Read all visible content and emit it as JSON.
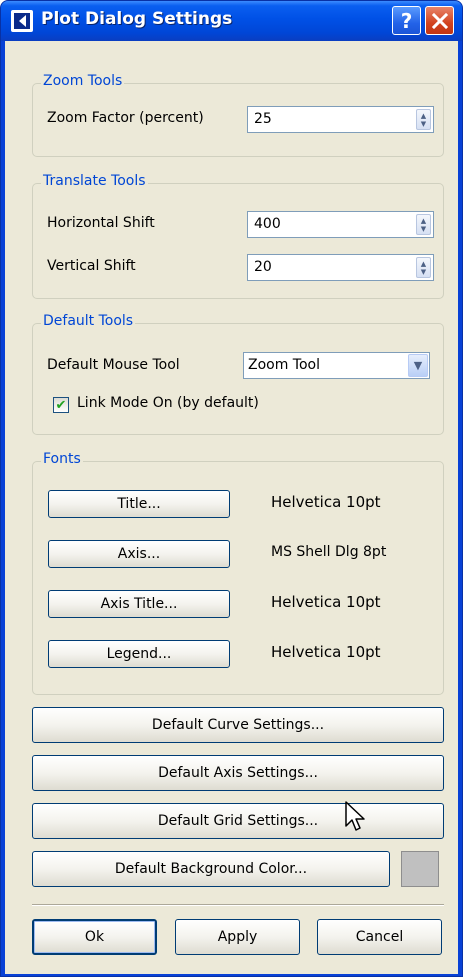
{
  "window": {
    "title": "Plot Dialog Settings"
  },
  "zoom_tools": {
    "group_label": "Zoom Tools",
    "zoom_factor_label": "Zoom Factor (percent)",
    "zoom_factor_value": "25"
  },
  "translate_tools": {
    "group_label": "Translate Tools",
    "horizontal_label": "Horizontal Shift",
    "horizontal_value": "400",
    "vertical_label": "Vertical Shift",
    "vertical_value": "20"
  },
  "default_tools": {
    "group_label": "Default Tools",
    "mouse_tool_label": "Default Mouse Tool",
    "mouse_tool_selected": "Zoom Tool",
    "link_mode_label": "Link Mode On (by default)",
    "link_mode_checked": true
  },
  "fonts": {
    "group_label": "Fonts",
    "items": [
      {
        "button": "Title...",
        "value": "Helvetica 10pt"
      },
      {
        "button": "Axis...",
        "value": "MS Shell Dlg 8pt"
      },
      {
        "button": "Axis Title...",
        "value": "Helvetica 10pt"
      },
      {
        "button": "Legend...",
        "value": "Helvetica 10pt"
      }
    ]
  },
  "defaults": {
    "curve_settings": "Default Curve Settings...",
    "axis_settings": "Default Axis Settings...",
    "grid_settings": "Default Grid Settings...",
    "background_color": "Default Background Color...",
    "background_swatch_color": "#c0c0c0"
  },
  "footer": {
    "ok": "Ok",
    "apply": "Apply",
    "cancel": "Cancel"
  },
  "colors": {
    "titlebar": "#0050e6",
    "client_bg": "#ece9d8",
    "group_label": "#0046d5"
  }
}
